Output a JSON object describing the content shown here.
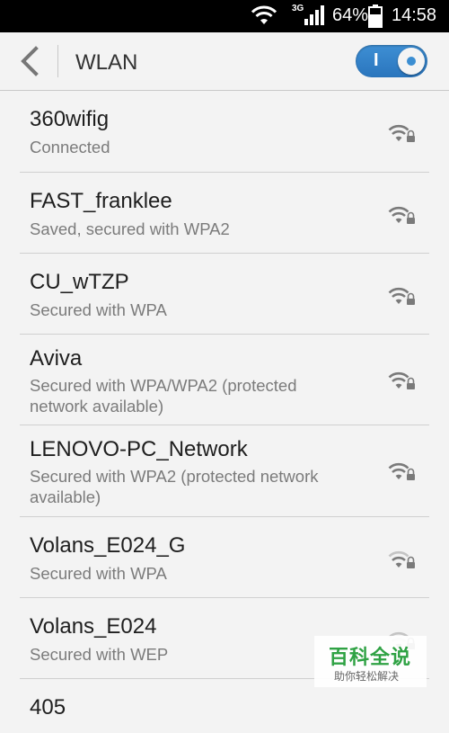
{
  "status_bar": {
    "network_type": "3G",
    "battery_percent": "64%",
    "time": "14:58",
    "wifi_icon": "wifi-icon",
    "signal_icon": "cell-signal-icon",
    "battery_icon": "battery-icon"
  },
  "header": {
    "back_icon": "chevron-left-icon",
    "title": "WLAN",
    "toggle_label": "I",
    "toggle_on": true,
    "accent_color": "#2f80c8"
  },
  "networks": [
    {
      "ssid": "360wifig",
      "status": "Connected",
      "signal": "strong",
      "locked": true
    },
    {
      "ssid": "FAST_franklee",
      "status": "Saved, secured with WPA2",
      "signal": "strong",
      "locked": true
    },
    {
      "ssid": "CU_wTZP",
      "status": "Secured with WPA",
      "signal": "strong",
      "locked": true
    },
    {
      "ssid": "Aviva",
      "status": "Secured with WPA/WPA2 (protected network available)",
      "signal": "strong",
      "locked": true
    },
    {
      "ssid": "LENOVO-PC_Network",
      "status": "Secured with WPA2 (protected network available)",
      "signal": "strong",
      "locked": true
    },
    {
      "ssid": "Volans_E024_G",
      "status": "Secured with WPA",
      "signal": "weak",
      "locked": true
    },
    {
      "ssid": "Volans_E024",
      "status": "Secured with WEP",
      "signal": "weak",
      "locked": true
    },
    {
      "ssid": "405",
      "status": "",
      "signal": "strong",
      "locked": true
    }
  ],
  "watermark": {
    "main": "百科全说",
    "sub": "助你轻松解决"
  }
}
